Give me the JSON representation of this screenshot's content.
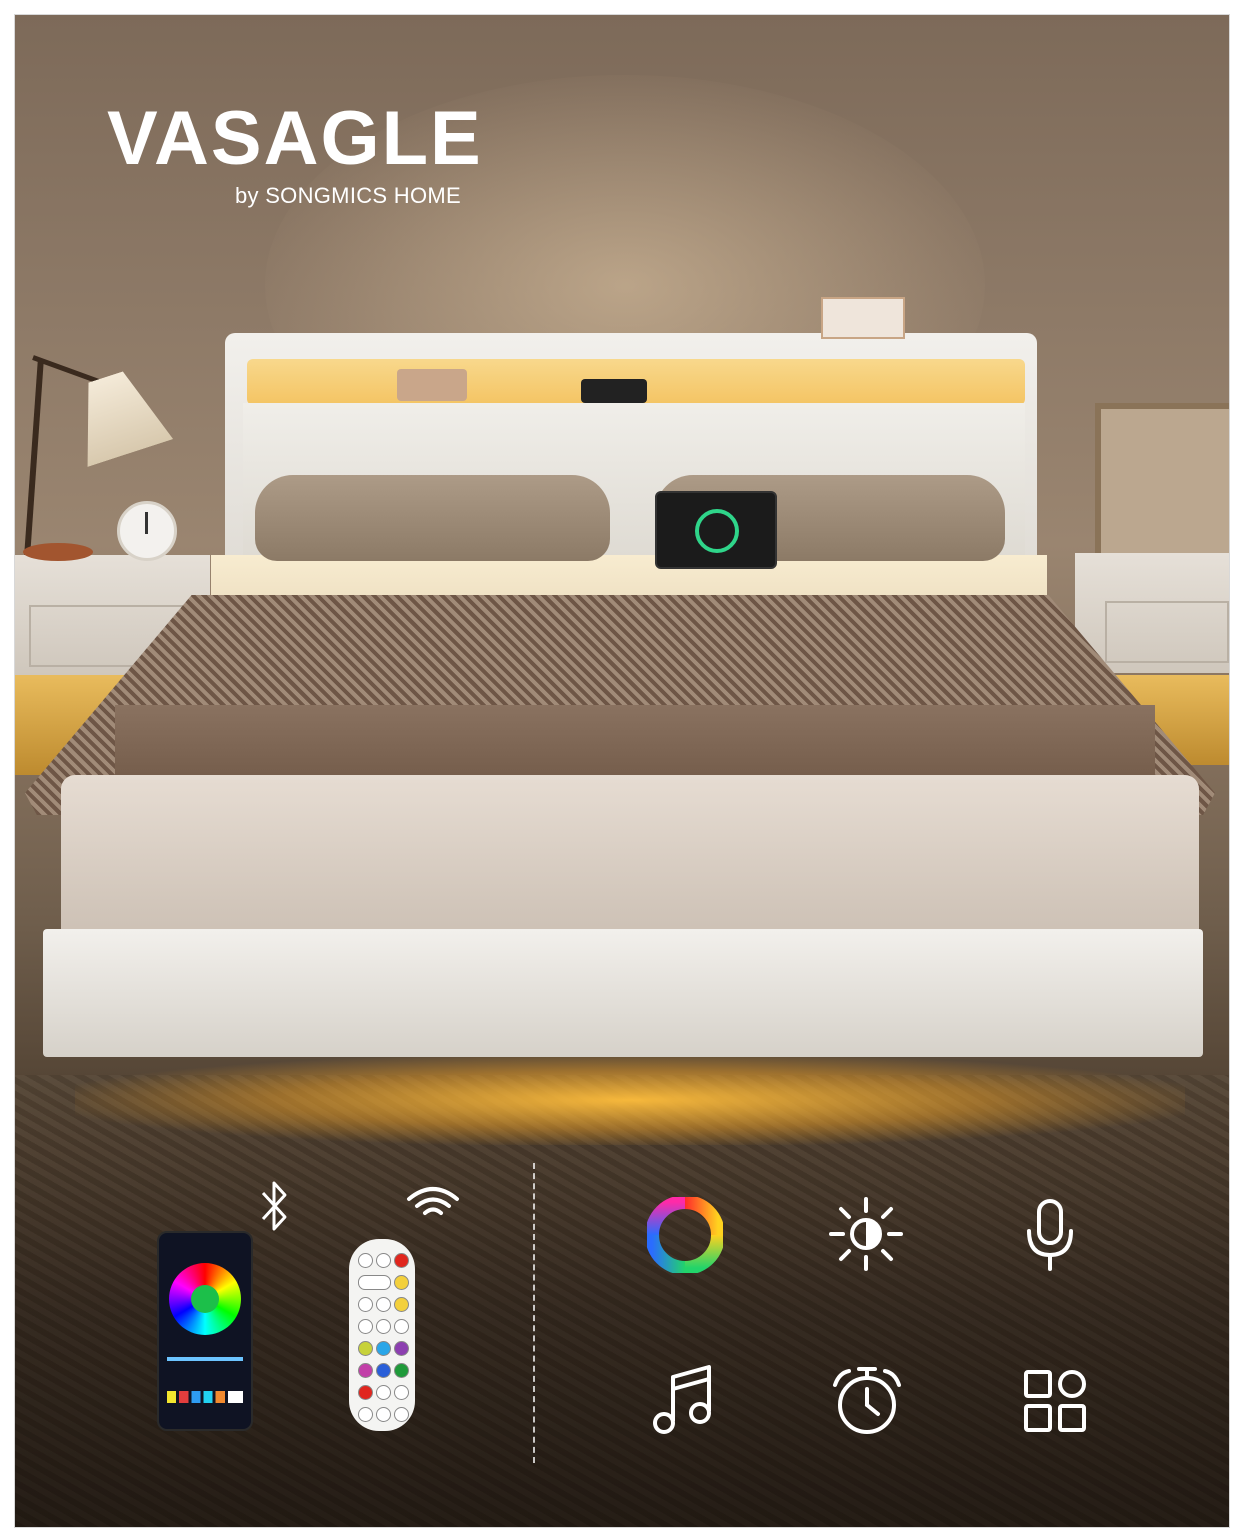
{
  "brand": {
    "name": "VASAGLE",
    "tagline": "by SONGMICS HOME"
  },
  "connectivity_icons": [
    "bluetooth-icon",
    "wifi-icon"
  ],
  "feature_icons": [
    "color-wheel-icon",
    "brightness-icon",
    "microphone-icon",
    "music-note-icon",
    "timer-icon",
    "modes-grid-icon"
  ],
  "colors": {
    "led_glow": "#f4c463",
    "headboard": "#f0eee9",
    "icon_white": "#ffffff"
  }
}
